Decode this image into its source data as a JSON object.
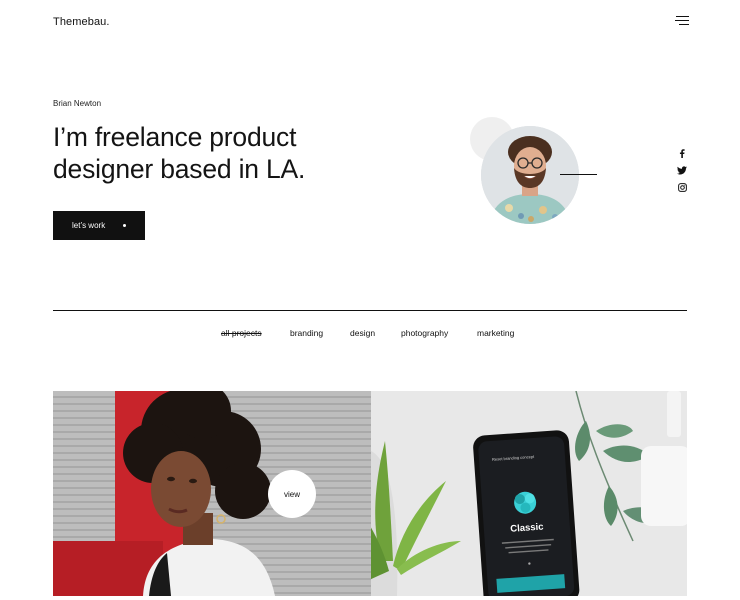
{
  "header": {
    "logo": "Themebau.",
    "menu_icon": "hamburger-menu-icon"
  },
  "hero": {
    "name": "Brian Newton",
    "title_line1": "I’m freelance product",
    "title_line2": "designer based in LA.",
    "cta_label": "let’s work"
  },
  "social": [
    {
      "icon": "facebook-icon"
    },
    {
      "icon": "twitter-icon"
    },
    {
      "icon": "instagram-icon"
    }
  ],
  "filters": [
    {
      "label": "all projects",
      "active": true
    },
    {
      "label": "branding",
      "active": false
    },
    {
      "label": "design",
      "active": false
    },
    {
      "label": "photography",
      "active": false
    },
    {
      "label": "marketing",
      "active": false
    }
  ],
  "gallery": {
    "view_label": "view",
    "phone": {
      "top_label": "Reset branding concept",
      "title": "Classic",
      "body": "Lorem ipsum dolor sit amet consectetur adipiscing elit sed do eiusmod tempor"
    }
  },
  "colors": {
    "text": "#111111",
    "button_bg": "#111111",
    "accent_teal": "#1fa3a8"
  }
}
